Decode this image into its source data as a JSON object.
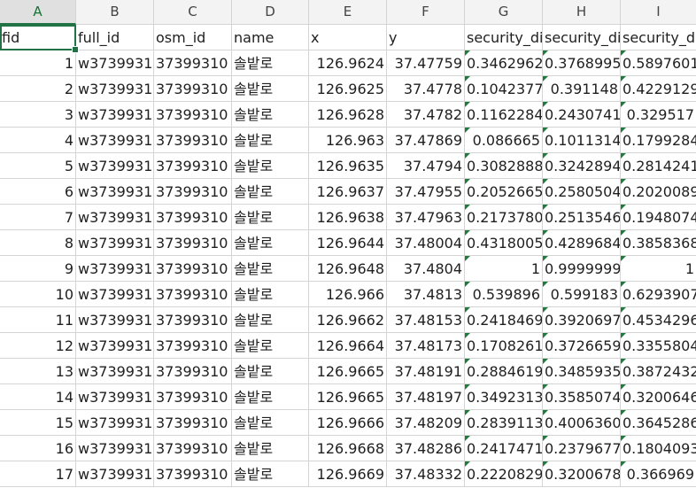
{
  "columns": [
    {
      "letter": "A",
      "align": "right"
    },
    {
      "letter": "B",
      "align": "left"
    },
    {
      "letter": "C",
      "align": "left"
    },
    {
      "letter": "D",
      "align": "left"
    },
    {
      "letter": "E",
      "align": "right"
    },
    {
      "letter": "F",
      "align": "right"
    },
    {
      "letter": "G",
      "align": "right"
    },
    {
      "letter": "H",
      "align": "right"
    },
    {
      "letter": "I",
      "align": "right"
    }
  ],
  "active_column": "A",
  "selected_cell": "A1",
  "header_row": [
    "fid",
    "full_id",
    "osm_id",
    "name",
    "x",
    "y",
    "security_di",
    "security_di",
    "security_d"
  ],
  "rows": [
    [
      "1",
      "w3739931",
      "37399310",
      "솔밭로",
      "126.9624",
      "37.47759",
      "0.3462962",
      "0.3768995",
      "0.5897601"
    ],
    [
      "2",
      "w3739931",
      "37399310",
      "솔밭로",
      "126.9625",
      "37.4778",
      "0.1042377",
      "0.391148",
      "0.4229129"
    ],
    [
      "3",
      "w3739931",
      "37399310",
      "솔밭로",
      "126.9628",
      "37.4782",
      "0.1162284",
      "0.2430741",
      "0.329517"
    ],
    [
      "4",
      "w3739931",
      "37399310",
      "솔밭로",
      "126.963",
      "37.47869",
      "0.086665",
      "0.1011314",
      "0.1799284"
    ],
    [
      "5",
      "w3739931",
      "37399310",
      "솔밭로",
      "126.9635",
      "37.4794",
      "0.3082888",
      "0.3242894",
      "0.2814241"
    ],
    [
      "6",
      "w3739931",
      "37399310",
      "솔밭로",
      "126.9637",
      "37.47955",
      "0.2052665",
      "0.2580504",
      "0.2020089"
    ],
    [
      "7",
      "w3739931",
      "37399310",
      "솔밭로",
      "126.9638",
      "37.47963",
      "0.2173780",
      "0.2513546",
      "0.1948074"
    ],
    [
      "8",
      "w3739931",
      "37399310",
      "솔밭로",
      "126.9644",
      "37.48004",
      "0.4318005",
      "0.4289684",
      "0.3858368"
    ],
    [
      "9",
      "w3739931",
      "37399310",
      "솔밭로",
      "126.9648",
      "37.4804",
      "1",
      "0.9999999",
      "1"
    ],
    [
      "10",
      "w3739931",
      "37399310",
      "솔밭로",
      "126.966",
      "37.4813",
      "0.539896",
      "0.599183",
      "0.6293907"
    ],
    [
      "11",
      "w3739931",
      "37399310",
      "솔밭로",
      "126.9662",
      "37.48153",
      "0.2418469",
      "0.3920697",
      "0.4534296"
    ],
    [
      "12",
      "w3739931",
      "37399310",
      "솔밭로",
      "126.9664",
      "37.48173",
      "0.1708261",
      "0.3726659",
      "0.3355804"
    ],
    [
      "13",
      "w3739931",
      "37399310",
      "솔밭로",
      "126.9665",
      "37.48191",
      "0.2884619",
      "0.3485935",
      "0.3872432"
    ],
    [
      "14",
      "w3739931",
      "37399310",
      "솔밭로",
      "126.9665",
      "37.48197",
      "0.3492313",
      "0.3585074",
      "0.3200646"
    ],
    [
      "15",
      "w3739931",
      "37399310",
      "솔밭로",
      "126.9666",
      "37.48209",
      "0.2839113",
      "0.4006360",
      "0.3645286"
    ],
    [
      "16",
      "w3739931",
      "37399310",
      "솔밭로",
      "126.9668",
      "37.48286",
      "0.2417471",
      "0.2379677",
      "0.1804093"
    ],
    [
      "17",
      "w3739931",
      "37399310",
      "솔밭로",
      "126.9669",
      "37.48332",
      "0.2220829",
      "0.3200678",
      "0.366969"
    ]
  ],
  "green_triangle_columns": [
    6,
    7,
    8
  ],
  "colors": {
    "accent": "#217346",
    "header_bg": "#f3f3f3",
    "active_header_bg": "#e0e0e0",
    "gridline": "#d4d4d4",
    "error_triangle": "#1e7b3a"
  }
}
